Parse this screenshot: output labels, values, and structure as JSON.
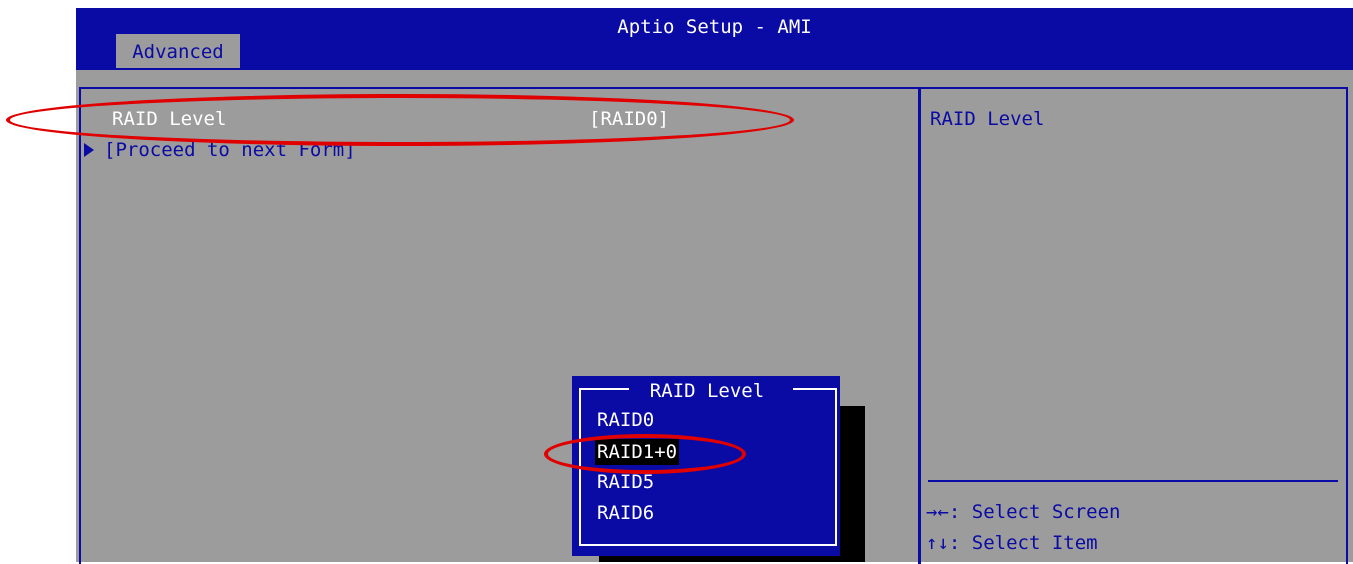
{
  "header": {
    "title": "Aptio Setup - AMI",
    "active_tab": "Advanced"
  },
  "main": {
    "items": [
      {
        "label": "RAID Level",
        "value": "[RAID0]"
      },
      {
        "label": "[Proceed to next Form]"
      }
    ]
  },
  "help": {
    "text": "RAID Level",
    "keys": [
      {
        "key": "→←:",
        "action": "Select Screen"
      },
      {
        "key": "↑↓:",
        "action": "Select Item"
      }
    ]
  },
  "popup": {
    "title": "RAID Level",
    "options": [
      "RAID0",
      "RAID1+0",
      "RAID5",
      "RAID6"
    ],
    "selected": "RAID1+0"
  },
  "colors": {
    "bios_blue": "#0a0aa4",
    "bios_gray": "#9c9c9c",
    "annotation_red": "#e00000"
  }
}
